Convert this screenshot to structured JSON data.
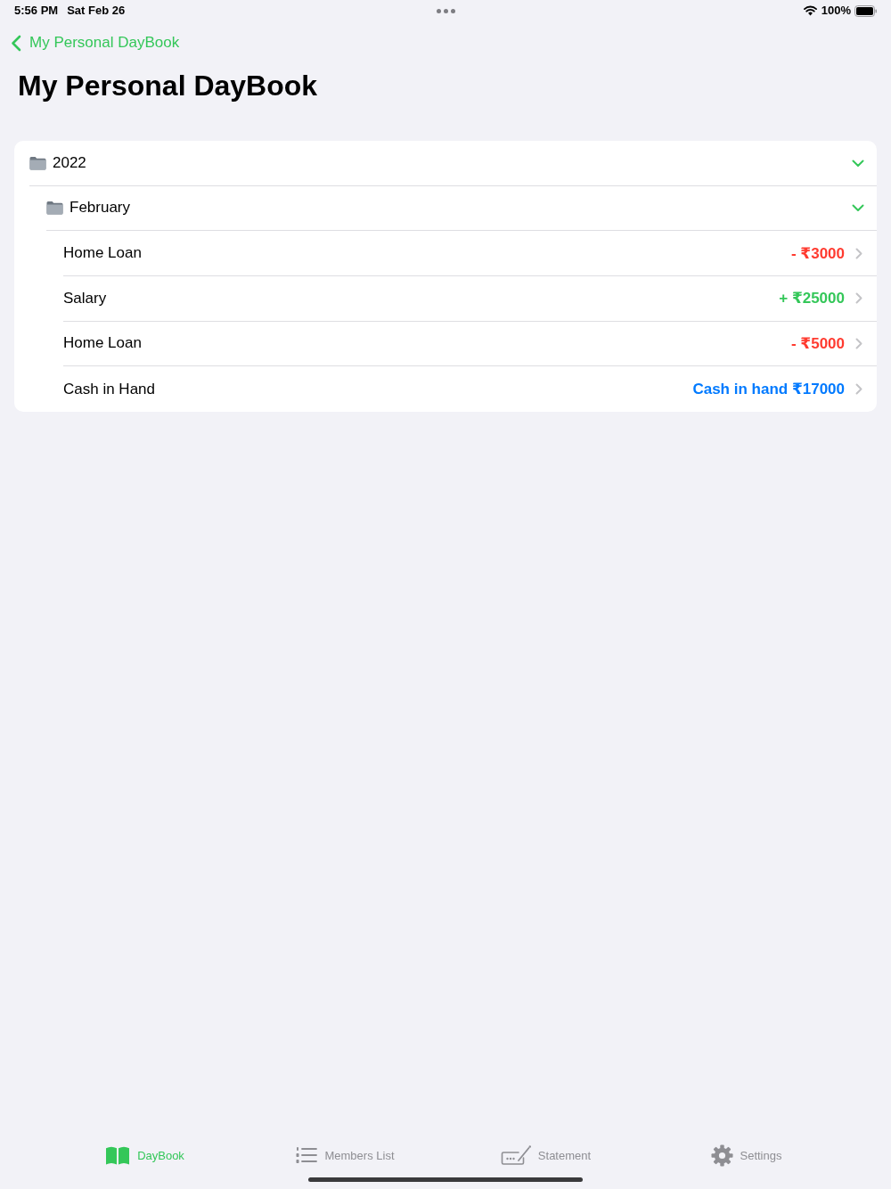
{
  "status_bar": {
    "time": "5:56 PM",
    "date": "Sat Feb 26",
    "battery": "100%"
  },
  "navigation": {
    "back_label": "My Personal DayBook",
    "title": "My Personal DayBook"
  },
  "tree": [
    {
      "kind": "folder",
      "label": "2022",
      "expanded": true,
      "children": [
        {
          "kind": "folder",
          "label": "February",
          "expanded": true,
          "children": [
            {
              "kind": "debit",
              "label": "Home Loan",
              "amount": "- ₹3000"
            },
            {
              "kind": "credit",
              "label": "Salary",
              "amount": "+ ₹25000"
            },
            {
              "kind": "debit",
              "label": "Home Loan",
              "amount": "- ₹5000"
            },
            {
              "kind": "balance",
              "label": "Cash in Hand",
              "amount": "Cash in hand ₹17000"
            }
          ]
        }
      ]
    }
  ],
  "tabs": [
    {
      "label": "DayBook",
      "selected": true
    },
    {
      "label": "Members List",
      "selected": false
    },
    {
      "label": "Statement",
      "selected": false
    },
    {
      "label": "Settings",
      "selected": false
    }
  ]
}
